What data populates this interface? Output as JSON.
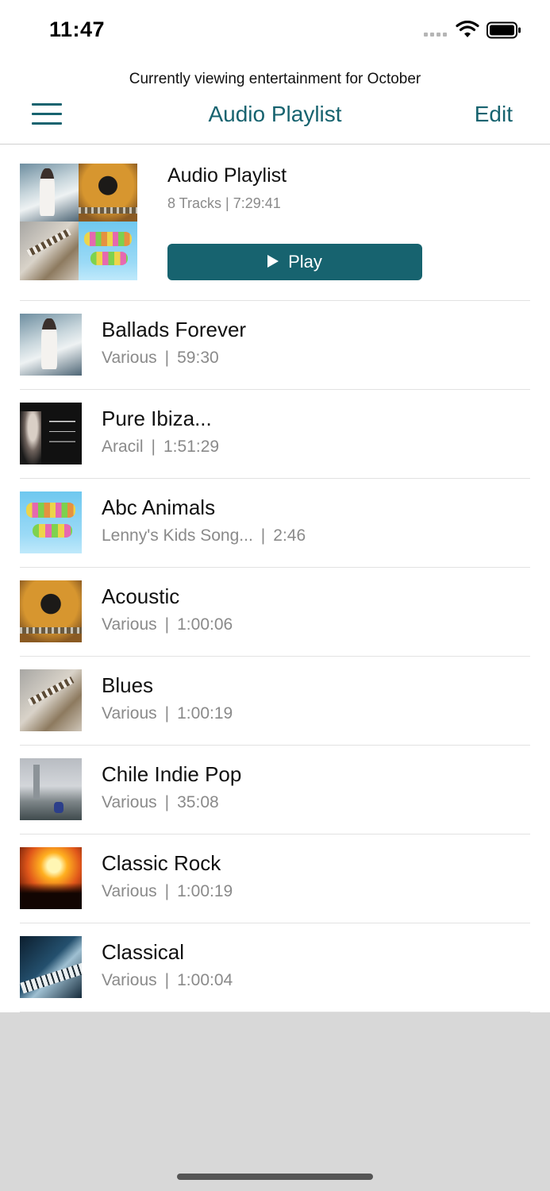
{
  "status_bar": {
    "time": "11:47",
    "icons": [
      "cellular-signal-icon",
      "wifi-icon",
      "battery-icon"
    ]
  },
  "header": {
    "notice": "Currently viewing entertainment for October",
    "title": "Audio Playlist",
    "edit_label": "Edit",
    "menu_icon": "hamburger-menu-icon"
  },
  "summary": {
    "title": "Audio Playlist",
    "meta": "8 Tracks | 7:29:41",
    "play_label": "Play",
    "cover_tiles": [
      "ballads",
      "acoustic-guitar",
      "blues",
      "learning-with-animals"
    ]
  },
  "separator": "|",
  "tracks": [
    {
      "title": "Ballads Forever",
      "artist": "Various",
      "duration": "59:30",
      "art": "ballads"
    },
    {
      "title": "Pure Ibiza...",
      "artist": "Aracil",
      "duration": "1:51:29",
      "art": "ibiza"
    },
    {
      "title": "Abc Animals",
      "artist": "Lenny's Kids Song...",
      "duration": "2:46",
      "art": "animals"
    },
    {
      "title": "Acoustic",
      "artist": "Various",
      "duration": "1:00:06",
      "art": "guitar"
    },
    {
      "title": "Blues",
      "artist": "Various",
      "duration": "1:00:19",
      "art": "blues"
    },
    {
      "title": "Chile Indie Pop",
      "artist": "Various",
      "duration": "35:08",
      "art": "chile"
    },
    {
      "title": "Classic Rock",
      "artist": "Various",
      "duration": "1:00:19",
      "art": "rock"
    },
    {
      "title": "Classical",
      "artist": "Various",
      "duration": "1:00:04",
      "art": "classical"
    }
  ],
  "colors": {
    "accent": "#17636f",
    "secondary_text": "#8a8a8a",
    "background_bottom": "#d8d8d8"
  }
}
